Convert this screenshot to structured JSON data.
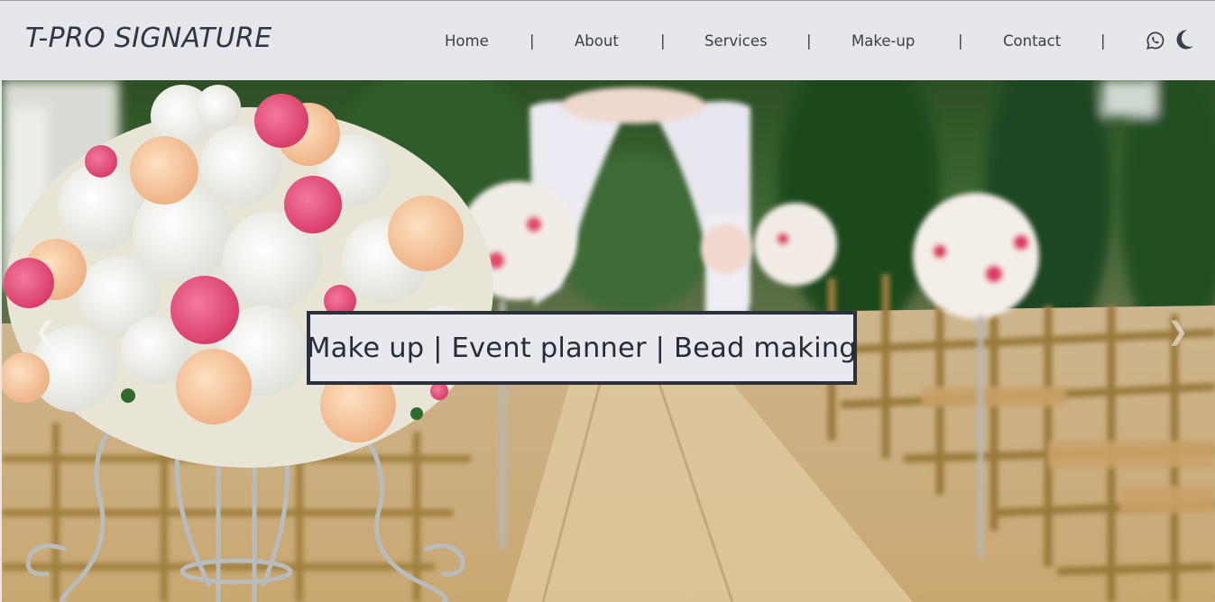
{
  "brand": {
    "name": "T-PRO SIGNATURE"
  },
  "nav": {
    "items": [
      {
        "label": "Home"
      },
      {
        "label": "About"
      },
      {
        "label": "Services"
      },
      {
        "label": "Make-up"
      },
      {
        "label": "Contact"
      }
    ],
    "separator": "|",
    "icons": [
      "whatsapp-icon",
      "moon-icon"
    ]
  },
  "hero": {
    "caption": "Make up | Event planner | Bead making",
    "prev_arrow": "❮",
    "next_arrow": "❯"
  },
  "colors": {
    "navbar_bg": "#e6e7ea",
    "text_dark": "#2f3642",
    "caption_bg": "#e8e9ee",
    "caption_border": "#2a303c"
  }
}
